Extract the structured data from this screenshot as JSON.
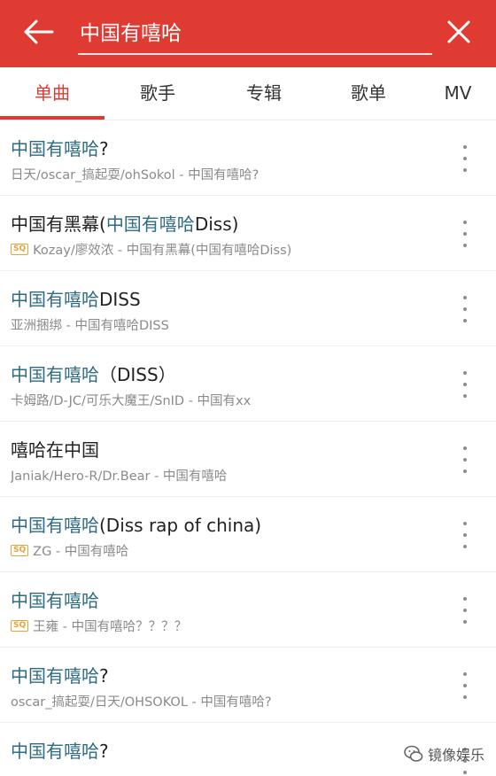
{
  "header": {
    "search_value": "中国有嘻哈",
    "bg_color": "#e03b33"
  },
  "tabs": [
    {
      "label": "单曲",
      "active": true
    },
    {
      "label": "歌手",
      "active": false
    },
    {
      "label": "专辑",
      "active": false
    },
    {
      "label": "歌单",
      "active": false
    },
    {
      "label": "MV",
      "active": false
    }
  ],
  "songs": [
    {
      "title_hl": "中国有嘻哈",
      "title_rest": "?",
      "title_hl2": "",
      "title_tail": "",
      "quality": "",
      "subtitle": "日天/oscar_搞起耍/ohSokol - 中国有嘻哈?"
    },
    {
      "title_hl": "",
      "title_rest": "中国有黑幕(",
      "title_hl2": "中国有嘻哈",
      "title_tail": "Diss)",
      "quality": "SQ",
      "subtitle": "Kozay/廖效浓 - 中国有黑幕(中国有嘻哈Diss)"
    },
    {
      "title_hl": "中国有嘻哈",
      "title_rest": "DISS",
      "title_hl2": "",
      "title_tail": "",
      "quality": "",
      "subtitle": "亚洲捆绑 - 中国有嘻哈DISS"
    },
    {
      "title_hl": "中国有嘻哈",
      "title_rest": "（DISS）",
      "title_hl2": "",
      "title_tail": "",
      "quality": "",
      "subtitle": "卡姆路/D-JC/可乐大魔王/SnID - 中国有xx"
    },
    {
      "title_hl": "",
      "title_rest": "嘻哈在中国",
      "title_hl2": "",
      "title_tail": "",
      "quality": "",
      "subtitle": "Janiak/Hero-R/Dr.Bear - 中国有嘻哈"
    },
    {
      "title_hl": "中国有嘻哈",
      "title_rest": "(Diss rap of china)",
      "title_hl2": "",
      "title_tail": "",
      "quality": "SQ",
      "subtitle": "ZG - 中国有嘻哈"
    },
    {
      "title_hl": "中国有嘻哈",
      "title_rest": "",
      "title_hl2": "",
      "title_tail": "",
      "quality": "SQ",
      "subtitle": "王雍 - 中国有嘻哈？？？？"
    },
    {
      "title_hl": "中国有嘻哈",
      "title_rest": "?",
      "title_hl2": "",
      "title_tail": "",
      "quality": "",
      "subtitle": "oscar_搞起耍/日天/OHSOKOL - 中国有嘻哈?"
    },
    {
      "title_hl": "中国有嘻哈",
      "title_rest": "?",
      "title_hl2": "",
      "title_tail": "",
      "quality": "",
      "subtitle": ""
    }
  ],
  "watermark": {
    "text": "镜像娱乐"
  }
}
